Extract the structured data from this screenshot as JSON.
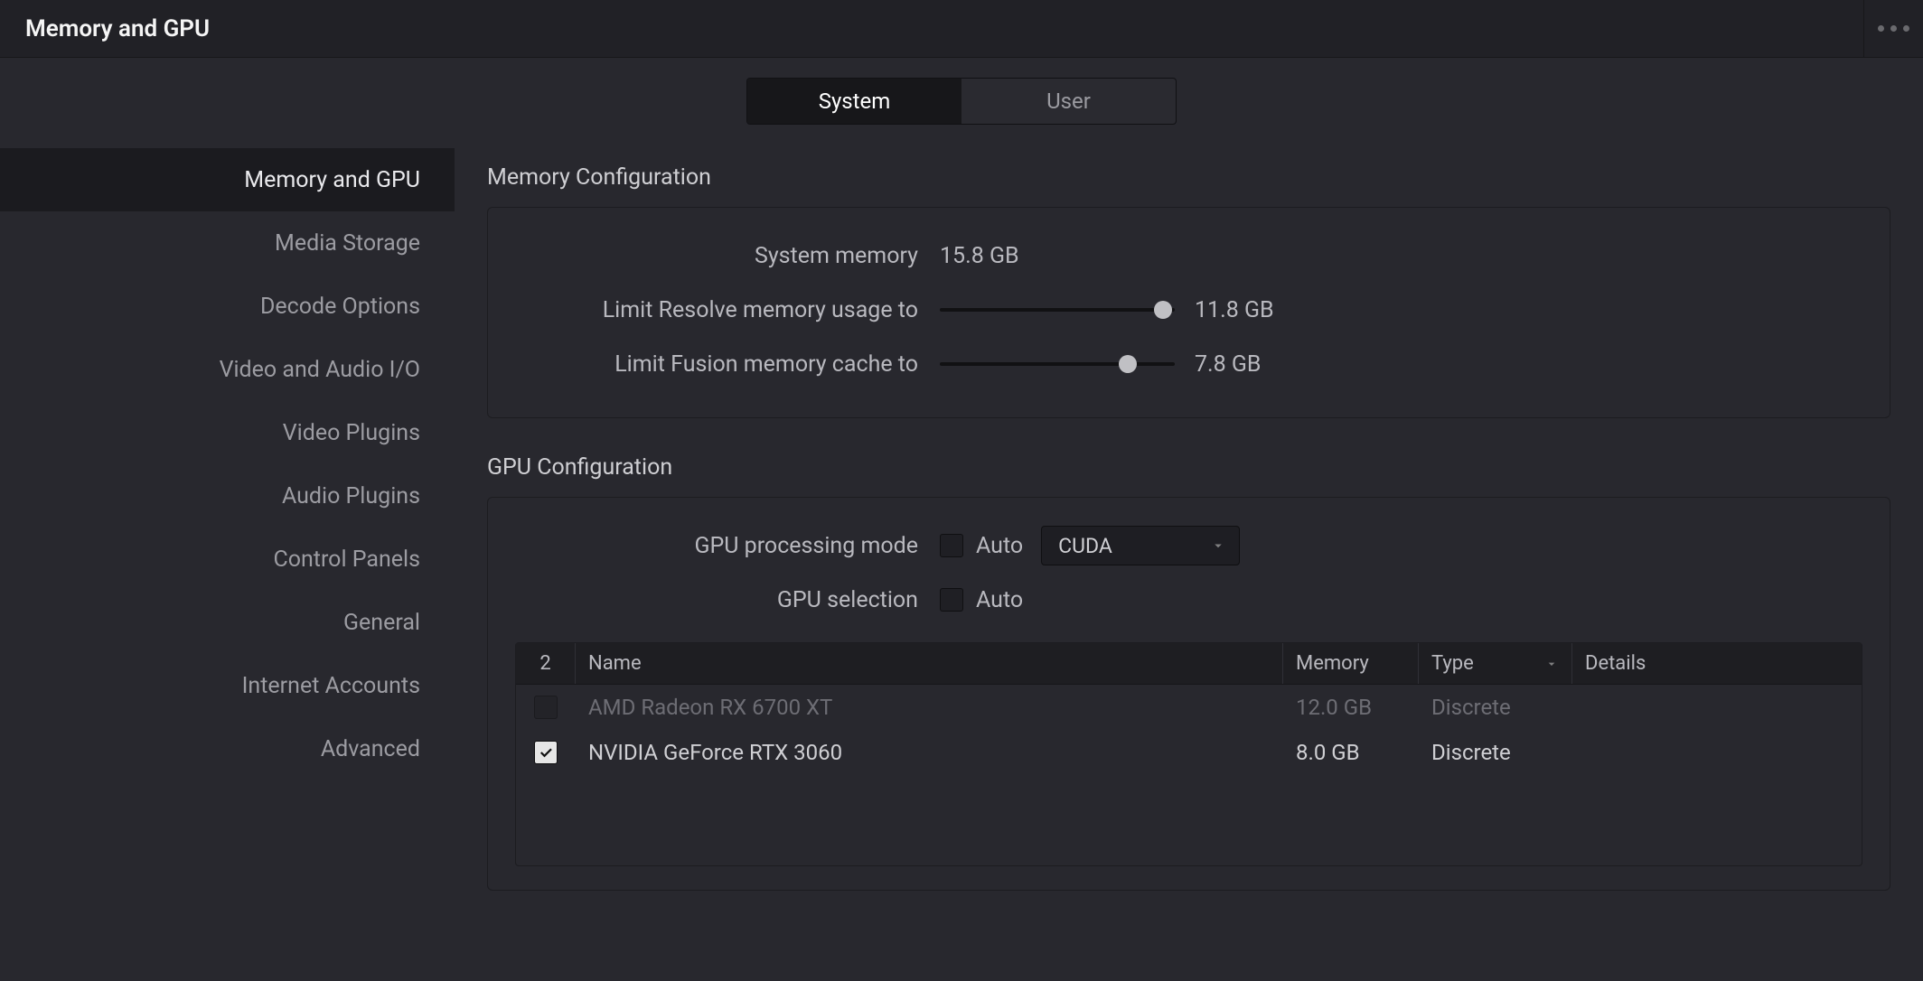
{
  "titlebar": {
    "title": "Memory and GPU"
  },
  "tabs": {
    "system": "System",
    "user": "User"
  },
  "sidebar": {
    "items": [
      {
        "label": "Memory and GPU",
        "active": true
      },
      {
        "label": "Media Storage",
        "active": false
      },
      {
        "label": "Decode Options",
        "active": false
      },
      {
        "label": "Video and Audio I/O",
        "active": false
      },
      {
        "label": "Video Plugins",
        "active": false
      },
      {
        "label": "Audio Plugins",
        "active": false
      },
      {
        "label": "Control Panels",
        "active": false
      },
      {
        "label": "General",
        "active": false
      },
      {
        "label": "Internet Accounts",
        "active": false
      },
      {
        "label": "Advanced",
        "active": false
      }
    ]
  },
  "memory": {
    "section_title": "Memory Configuration",
    "system_label": "System memory",
    "system_value": "15.8 GB",
    "resolve_label": "Limit Resolve memory usage to",
    "resolve_value": "11.8 GB",
    "resolve_slider_pct": 95,
    "fusion_label": "Limit Fusion memory cache to",
    "fusion_value": "7.8 GB",
    "fusion_slider_pct": 80
  },
  "gpu": {
    "section_title": "GPU Configuration",
    "mode_label": "GPU processing mode",
    "mode_auto_label": "Auto",
    "mode_auto_checked": false,
    "mode_select_value": "CUDA",
    "selection_label": "GPU selection",
    "selection_auto_label": "Auto",
    "selection_auto_checked": false,
    "table": {
      "count": "2",
      "col_name": "Name",
      "col_memory": "Memory",
      "col_type": "Type",
      "col_details": "Details",
      "rows": [
        {
          "checked": false,
          "disabled": true,
          "name": "AMD Radeon RX 6700 XT",
          "memory": "12.0 GB",
          "type": "Discrete",
          "details": ""
        },
        {
          "checked": true,
          "disabled": false,
          "name": "NVIDIA GeForce RTX 3060",
          "memory": "8.0 GB",
          "type": "Discrete",
          "details": ""
        }
      ]
    }
  }
}
